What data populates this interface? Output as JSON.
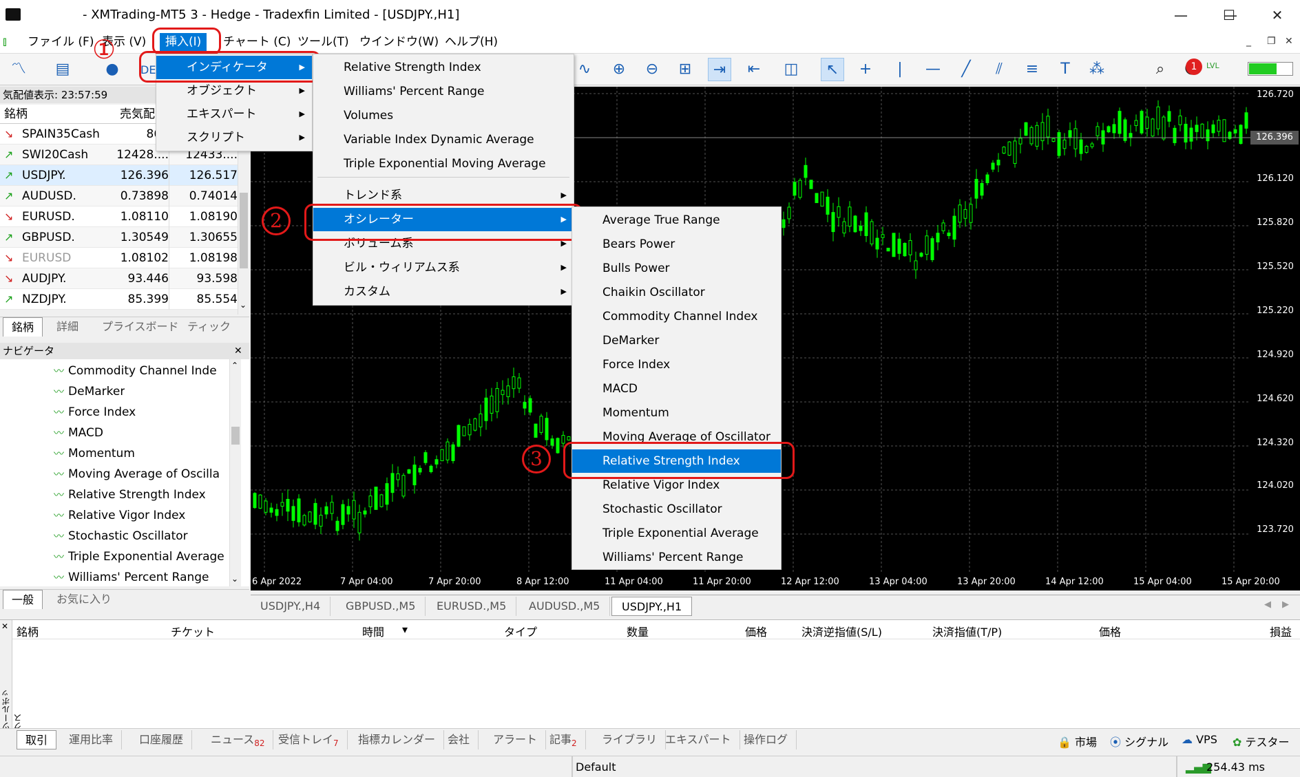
{
  "window": {
    "title": "- XMTrading-MT5 3 - Hedge - Tradexfin Limited - [USDJPY.,H1]",
    "minimize": "—",
    "maximize": "☐",
    "close": "✕"
  },
  "menubar": {
    "items": [
      "ファイル (F)",
      "表示 (V)",
      "挿入(I)",
      "チャート (C)",
      "ツール(T)",
      "ウインドウ(W)",
      "ヘルプ(H)"
    ],
    "mdi_minimize": "_",
    "mdi_restore": "❐",
    "mdi_close": "✕"
  },
  "toolbar": {
    "de_label": "DE"
  },
  "market_watch": {
    "header": "気配値表示: 23:57:59",
    "col_symbol": "銘柄",
    "col_bid": "売気配",
    "rows": [
      {
        "arrow": "↘",
        "symbol": "SPAIN35Cash",
        "bid": "867",
        "ask": "",
        "dir": "down"
      },
      {
        "arrow": "↗",
        "symbol": "SWI20Cash",
        "bid": "12428....",
        "ask": "12433....",
        "dir": "up"
      },
      {
        "arrow": "↗",
        "symbol": "USDJPY.",
        "bid": "126.396",
        "ask": "126.517",
        "dir": "up"
      },
      {
        "arrow": "↗",
        "symbol": "AUDUSD.",
        "bid": "0.73898",
        "ask": "0.74014",
        "dir": "up"
      },
      {
        "arrow": "↘",
        "symbol": "EURUSD.",
        "bid": "1.08110",
        "ask": "1.08190",
        "dir": "down"
      },
      {
        "arrow": "↗",
        "symbol": "GBPUSD.",
        "bid": "1.30549",
        "ask": "1.30655",
        "dir": "up"
      },
      {
        "arrow": "↘",
        "symbol": "EURUSD",
        "bid": "1.08102",
        "ask": "1.08198",
        "dir": "down"
      },
      {
        "arrow": "↘",
        "symbol": "AUDJPY.",
        "bid": "93.446",
        "ask": "93.598",
        "dir": "down"
      },
      {
        "arrow": "↗",
        "symbol": "NZDJPY.",
        "bid": "85.399",
        "ask": "85.554",
        "dir": "up"
      }
    ],
    "tabs": [
      "銘柄",
      "詳細",
      "プライスボード",
      "ティック"
    ]
  },
  "navigator": {
    "header": "ナビゲータ",
    "close": "✕",
    "items": [
      "Commodity Channel Inde",
      "DeMarker",
      "Force Index",
      "MACD",
      "Momentum",
      "Moving Average of Oscilla",
      "Relative Strength Index",
      "Relative Vigor Index",
      "Stochastic Oscillator",
      "Triple Exponential Average",
      "Williams' Percent Range"
    ],
    "tabs": [
      "一般",
      "お気に入り"
    ]
  },
  "menu_insert": {
    "items": [
      "インディケータ",
      "オブジェクト",
      "エキスパート",
      "スクリプト"
    ]
  },
  "menu_indicators": {
    "recent": [
      "Relative Strength Index",
      "Williams' Percent Range",
      "Volumes",
      "Variable Index Dynamic Average",
      "Triple Exponential Moving Average"
    ],
    "groups": [
      "トレンド系",
      "オシレーター",
      "ボリューム系",
      "ビル・ウィリアムス系",
      "カスタム"
    ]
  },
  "menu_oscillators": {
    "items": [
      "Average True Range",
      "Bears Power",
      "Bulls Power",
      "Chaikin Oscillator",
      "Commodity Channel Index",
      "DeMarker",
      "Force Index",
      "MACD",
      "Momentum",
      "Moving Average of Oscillator",
      "Relative Strength Index",
      "Relative Vigor Index",
      "Stochastic Oscillator",
      "Triple Exponential Average",
      "Williams' Percent Range"
    ]
  },
  "annotations": {
    "step1": "①",
    "step2": "2",
    "step3": "3"
  },
  "chart": {
    "symbol": "USDJPY.,H1",
    "current_price": "126.396",
    "price_labels": [
      "126.720",
      "126.120",
      "125.820",
      "125.520",
      "125.220",
      "124.920",
      "124.620",
      "124.320",
      "124.020",
      "123.720"
    ],
    "time_labels": [
      "6 Apr 2022",
      "7 Apr 04:00",
      "7 Apr 20:00",
      "8 Apr 12:00",
      "11 Apr 04:00",
      "11 Apr 20:00",
      "12 Apr 12:00",
      "13 Apr 04:00",
      "13 Apr 20:00",
      "14 Apr 12:00",
      "15 Apr 04:00",
      "15 Apr 20:00"
    ],
    "candle_color": "#00ff00"
  },
  "chart_tabs": [
    "USDJPY.,H4",
    "GBPUSD.,M5",
    "EURUSD.,M5",
    "AUDUSD.,M5",
    "USDJPY.,H1"
  ],
  "toolbox": {
    "vertical_label": "ツールボックス",
    "columns": [
      "銘柄",
      "チケット",
      "時間",
      "タイプ",
      "数量",
      "価格",
      "決済逆指値(S/L)",
      "決済指値(T/P)",
      "価格",
      "損益"
    ],
    "tabs": [
      {
        "label": "取引",
        "count": ""
      },
      {
        "label": "運用比率",
        "count": ""
      },
      {
        "label": "口座履歴",
        "count": ""
      },
      {
        "label": "ニュース",
        "count": "82"
      },
      {
        "label": "受信トレイ",
        "count": "7"
      },
      {
        "label": "指標カレンダー",
        "count": ""
      },
      {
        "label": "会社",
        "count": ""
      },
      {
        "label": "アラート",
        "count": ""
      },
      {
        "label": "記事",
        "count": "2"
      },
      {
        "label": "ライブラリ",
        "count": ""
      },
      {
        "label": "エキスパート",
        "count": ""
      },
      {
        "label": "操作ログ",
        "count": ""
      }
    ],
    "right_buttons": [
      "市場",
      "シグナル",
      "VPS",
      "テスター"
    ]
  },
  "notifications": "1",
  "lvl_label": "LVL",
  "status": {
    "profile": "Default",
    "ping": "254.43 ms"
  }
}
